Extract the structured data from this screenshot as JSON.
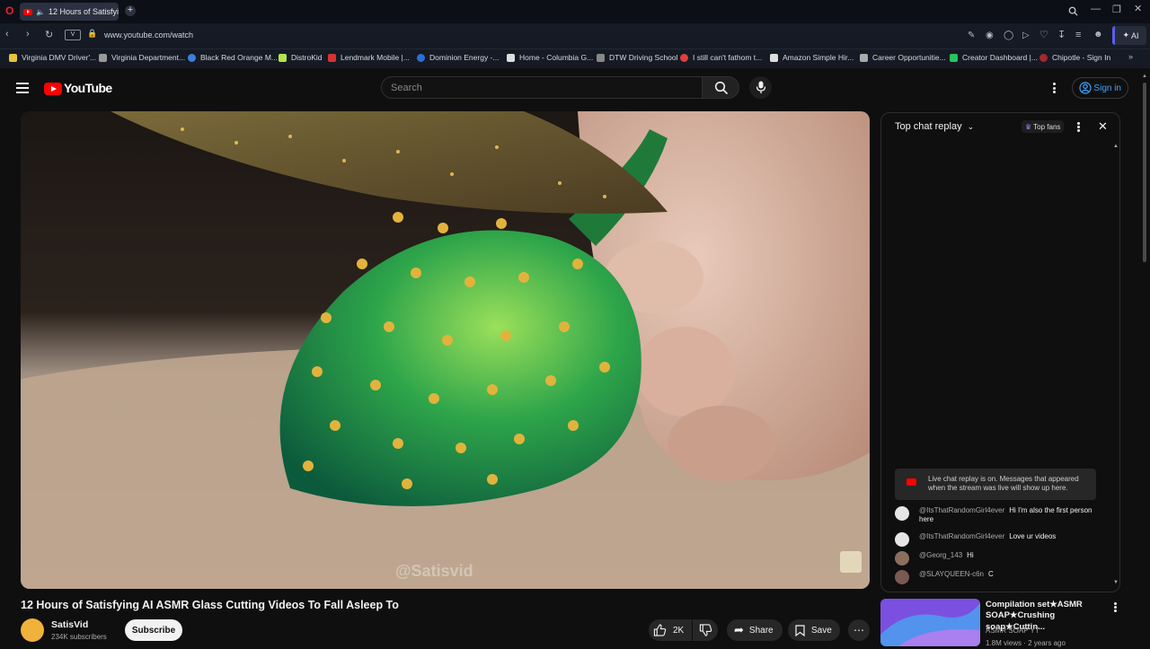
{
  "browser": {
    "tab_title": "12 Hours of Satisfying",
    "url": "www.youtube.com/watch",
    "ai_label": "AI",
    "bookmarks": [
      "Virginia DMV Driver'...",
      "Virginia Department...",
      "Black Red Orange M...",
      "DistroKid",
      "Lendmark Mobile |...",
      "Dominion Energy -...",
      "Home - Columbia G...",
      "DTW Driving School",
      "I still can't fathom t...",
      "Amazon Simple Hir...",
      "Career Opportunitie...",
      "Creator Dashboard |...",
      "Chipotle - Sign In"
    ]
  },
  "header": {
    "logo": "YouTube",
    "search_placeholder": "Search",
    "sign_in": "Sign in"
  },
  "video": {
    "watermark": "@Satisvid",
    "title": "12 Hours of Satisfying AI ASMR Glass Cutting Videos To Fall Asleep To",
    "channel": "SatisVid",
    "subscribers": "234K subscribers",
    "subscribe_label": "Subscribe",
    "likes": "2K",
    "share_label": "Share",
    "save_label": "Save"
  },
  "chat": {
    "header": "Top chat replay",
    "top_fans": "Top fans",
    "notice": "Live chat replay is on. Messages that appeared when the stream was live will show up here.",
    "messages": [
      {
        "author": "@ItsThatRandomGirl4ever",
        "text": "Hi I'm also the first person here"
      },
      {
        "author": "@ItsThatRandomGirl4ever",
        "text": "Love ur videos"
      },
      {
        "author": "@Georg_143",
        "text": "Hi"
      },
      {
        "author": "@SLAYQUEEN-c6n",
        "text": "C"
      }
    ]
  },
  "recommendation": {
    "title": "Compilation set★ASMR SOAP★Crushing soap★Cuttin...",
    "channel": "ASMR SOAP YT",
    "views": "1.8M views",
    "age": "2 years ago"
  }
}
